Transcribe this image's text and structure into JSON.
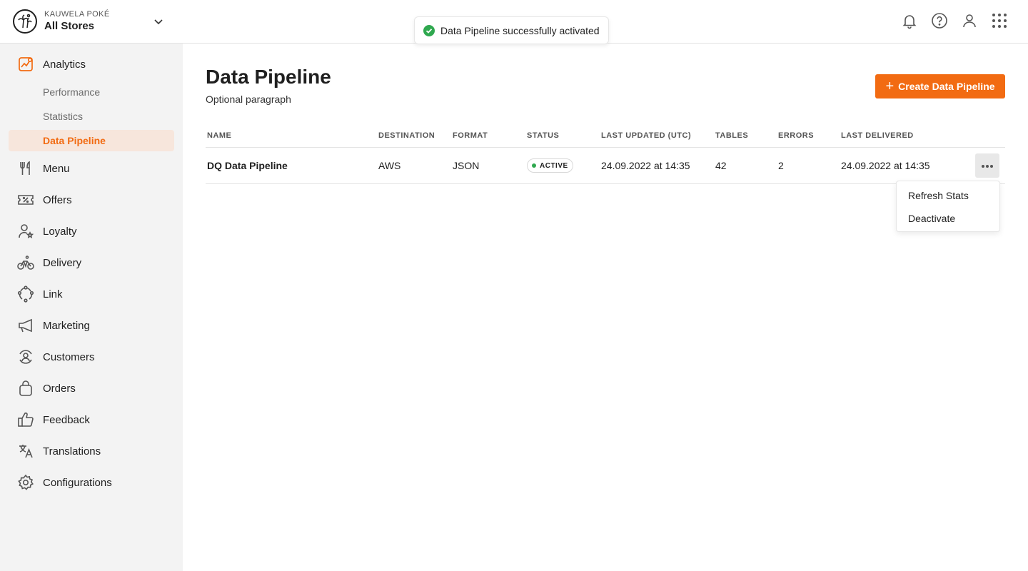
{
  "header": {
    "brand_name": "KAUWELA POKÉ",
    "store": "All Stores",
    "icons": [
      "bell-icon",
      "help-icon",
      "user-icon",
      "apps-grid-icon"
    ]
  },
  "toast": {
    "message": "Data Pipeline successfully activated",
    "color": "#2fa84f"
  },
  "sidebar": {
    "analytics": {
      "label": "Analytics",
      "sub_items": [
        {
          "label": "Performance"
        },
        {
          "label": "Statistics"
        },
        {
          "label": "Data Pipeline",
          "active": true
        }
      ]
    },
    "items": [
      {
        "label": "Menu",
        "icon": "fork-knife-icon"
      },
      {
        "label": "Offers",
        "icon": "ticket-icon"
      },
      {
        "label": "Loyalty",
        "icon": "user-star-icon"
      },
      {
        "label": "Delivery",
        "icon": "bike-icon"
      },
      {
        "label": "Link",
        "icon": "link-circle-icon"
      },
      {
        "label": "Marketing",
        "icon": "megaphone-icon"
      },
      {
        "label": "Customers",
        "icon": "customers-icon"
      },
      {
        "label": "Orders",
        "icon": "bag-icon"
      },
      {
        "label": "Feedback",
        "icon": "thumbs-up-icon"
      },
      {
        "label": "Translations",
        "icon": "translate-icon"
      },
      {
        "label": "Configurations",
        "icon": "gear-icon"
      }
    ]
  },
  "main": {
    "title": "Data Pipeline",
    "subtitle": "Optional paragraph",
    "create_button": "Create Data Pipeline",
    "accent_color": "#f26b12",
    "table": {
      "columns": [
        "NAME",
        "DESTINATION",
        "FORMAT",
        "STATUS",
        "LAST UPDATED (UTC)",
        "TABLES",
        "ERRORS",
        "LAST DELIVERED"
      ],
      "rows": [
        {
          "name": "DQ Data Pipeline",
          "destination": "AWS",
          "format": "JSON",
          "status": "ACTIVE",
          "last_updated": "24.09.2022 at 14:35",
          "tables": "42",
          "errors": "2",
          "last_delivered": "24.09.2022 at 14:35"
        }
      ]
    },
    "row_menu": {
      "items": [
        "Refresh Stats",
        "Deactivate"
      ]
    }
  }
}
